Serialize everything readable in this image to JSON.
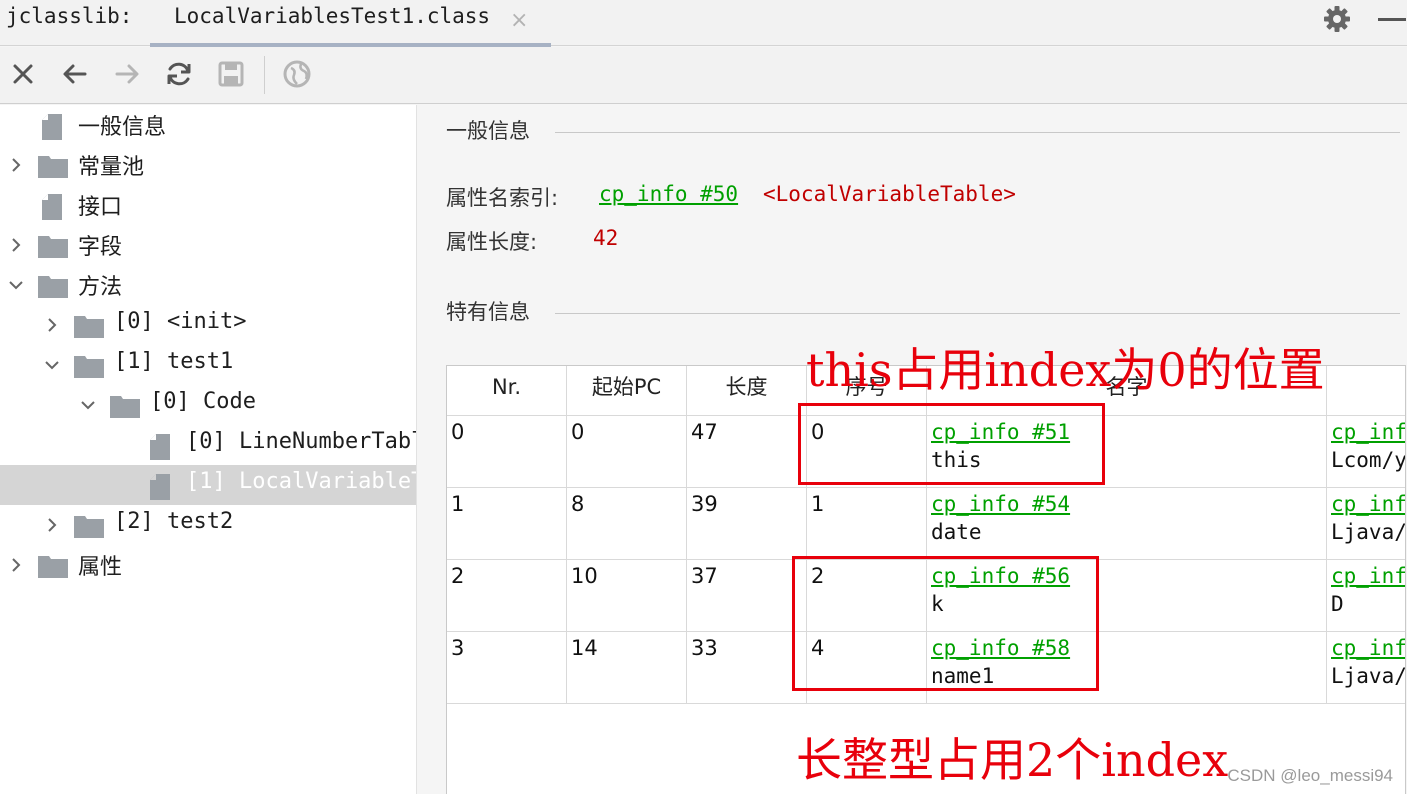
{
  "tabbar": {
    "prefix": "jclasslib:",
    "tab_title": "LocalVariablesTest1.class",
    "close_glyph": "×",
    "settings_icon": "gear-icon",
    "minimize_icon": "minimize-icon"
  },
  "toolbar": {
    "buttons": [
      {
        "icon": "close-icon"
      },
      {
        "icon": "back-arrow-icon"
      },
      {
        "icon": "forward-arrow-icon"
      },
      {
        "icon": "refresh-icon"
      },
      {
        "icon": "save-icon"
      },
      {
        "icon": "globe-icon"
      }
    ]
  },
  "tree": {
    "items": [
      {
        "label": "一般信息",
        "type": "file",
        "expanded": null
      },
      {
        "label": "常量池",
        "type": "folder",
        "expanded": false
      },
      {
        "label": "接口",
        "type": "file",
        "expanded": null
      },
      {
        "label": "字段",
        "type": "folder",
        "expanded": false
      },
      {
        "label": "方法",
        "type": "folder",
        "expanded": true
      },
      {
        "label": "[0] <init>",
        "type": "folder",
        "expanded": false
      },
      {
        "label": "[1] test1",
        "type": "folder",
        "expanded": true
      },
      {
        "label": "[0] Code",
        "type": "folder",
        "expanded": true
      },
      {
        "label": "[0] LineNumberTabl",
        "type": "file",
        "expanded": null
      },
      {
        "label": "[1] LocalVariableT",
        "type": "file",
        "expanded": null,
        "selected": true
      },
      {
        "label": "[2] test2",
        "type": "folder",
        "expanded": false
      },
      {
        "label": "属性",
        "type": "folder",
        "expanded": false
      }
    ]
  },
  "general": {
    "title": "一般信息",
    "name_index_label": "属性名索引:",
    "name_index_link": "cp_info #50",
    "name_index_value": "<LocalVariableTable>",
    "length_label": "属性长度:",
    "length_value": "42"
  },
  "specific": {
    "title": "特有信息"
  },
  "table": {
    "headers": [
      "Nr.",
      "起始PC",
      "长度",
      "序号",
      "名字",
      ""
    ],
    "rows": [
      {
        "nr": "0",
        "start_pc": "0",
        "length": "47",
        "index": "0",
        "name_link": "cp_info #51",
        "name": "this",
        "desc_link": "cp_inf",
        "desc": "Lcom/y"
      },
      {
        "nr": "1",
        "start_pc": "8",
        "length": "39",
        "index": "1",
        "name_link": "cp_info #54",
        "name": "date",
        "desc_link": "cp_inf",
        "desc": "Ljava/"
      },
      {
        "nr": "2",
        "start_pc": "10",
        "length": "37",
        "index": "2",
        "name_link": "cp_info #56",
        "name": "k",
        "desc_link": "cp_inf",
        "desc": "D"
      },
      {
        "nr": "3",
        "start_pc": "14",
        "length": "33",
        "index": "4",
        "name_link": "cp_info #58",
        "name": "name1",
        "desc_link": "cp_inf",
        "desc": "Ljava/"
      }
    ]
  },
  "annotations": {
    "top": "this占用index为0的位置",
    "bottom": "长整型占用2个index",
    "color": "#e8000b"
  },
  "watermark": "CSDN @leo_messi94",
  "colors": {
    "link": "#00a000",
    "value": "#c00000",
    "selected_row": "#d5d5d5"
  }
}
